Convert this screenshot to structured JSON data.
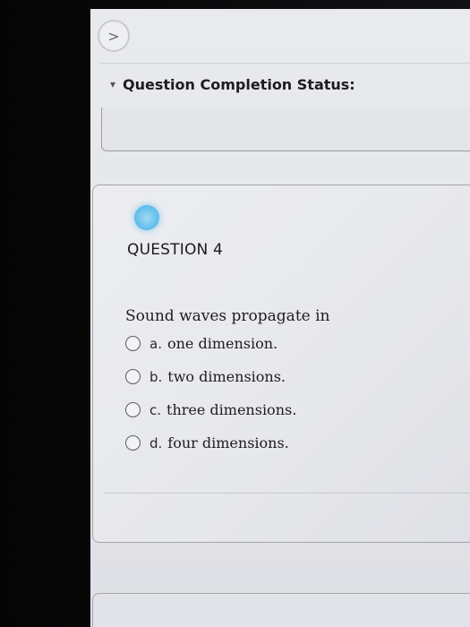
{
  "nav": {
    "arrow_glyph": ">",
    "icon": "chevron-right-icon"
  },
  "status": {
    "toggle_glyph": "▾",
    "label": "Question Completion Status:"
  },
  "question": {
    "number_label": "QUESTION 4",
    "prompt": "Sound waves propagate in",
    "options": [
      {
        "letter": "a.",
        "text": "one dimension."
      },
      {
        "letter": "b.",
        "text": "two dimensions."
      },
      {
        "letter": "c.",
        "text": "three dimensions."
      },
      {
        "letter": "d.",
        "text": "four dimensions."
      }
    ]
  },
  "colors": {
    "accent_dot": "#5cbbe9",
    "page_bg": "#e9eaee"
  }
}
